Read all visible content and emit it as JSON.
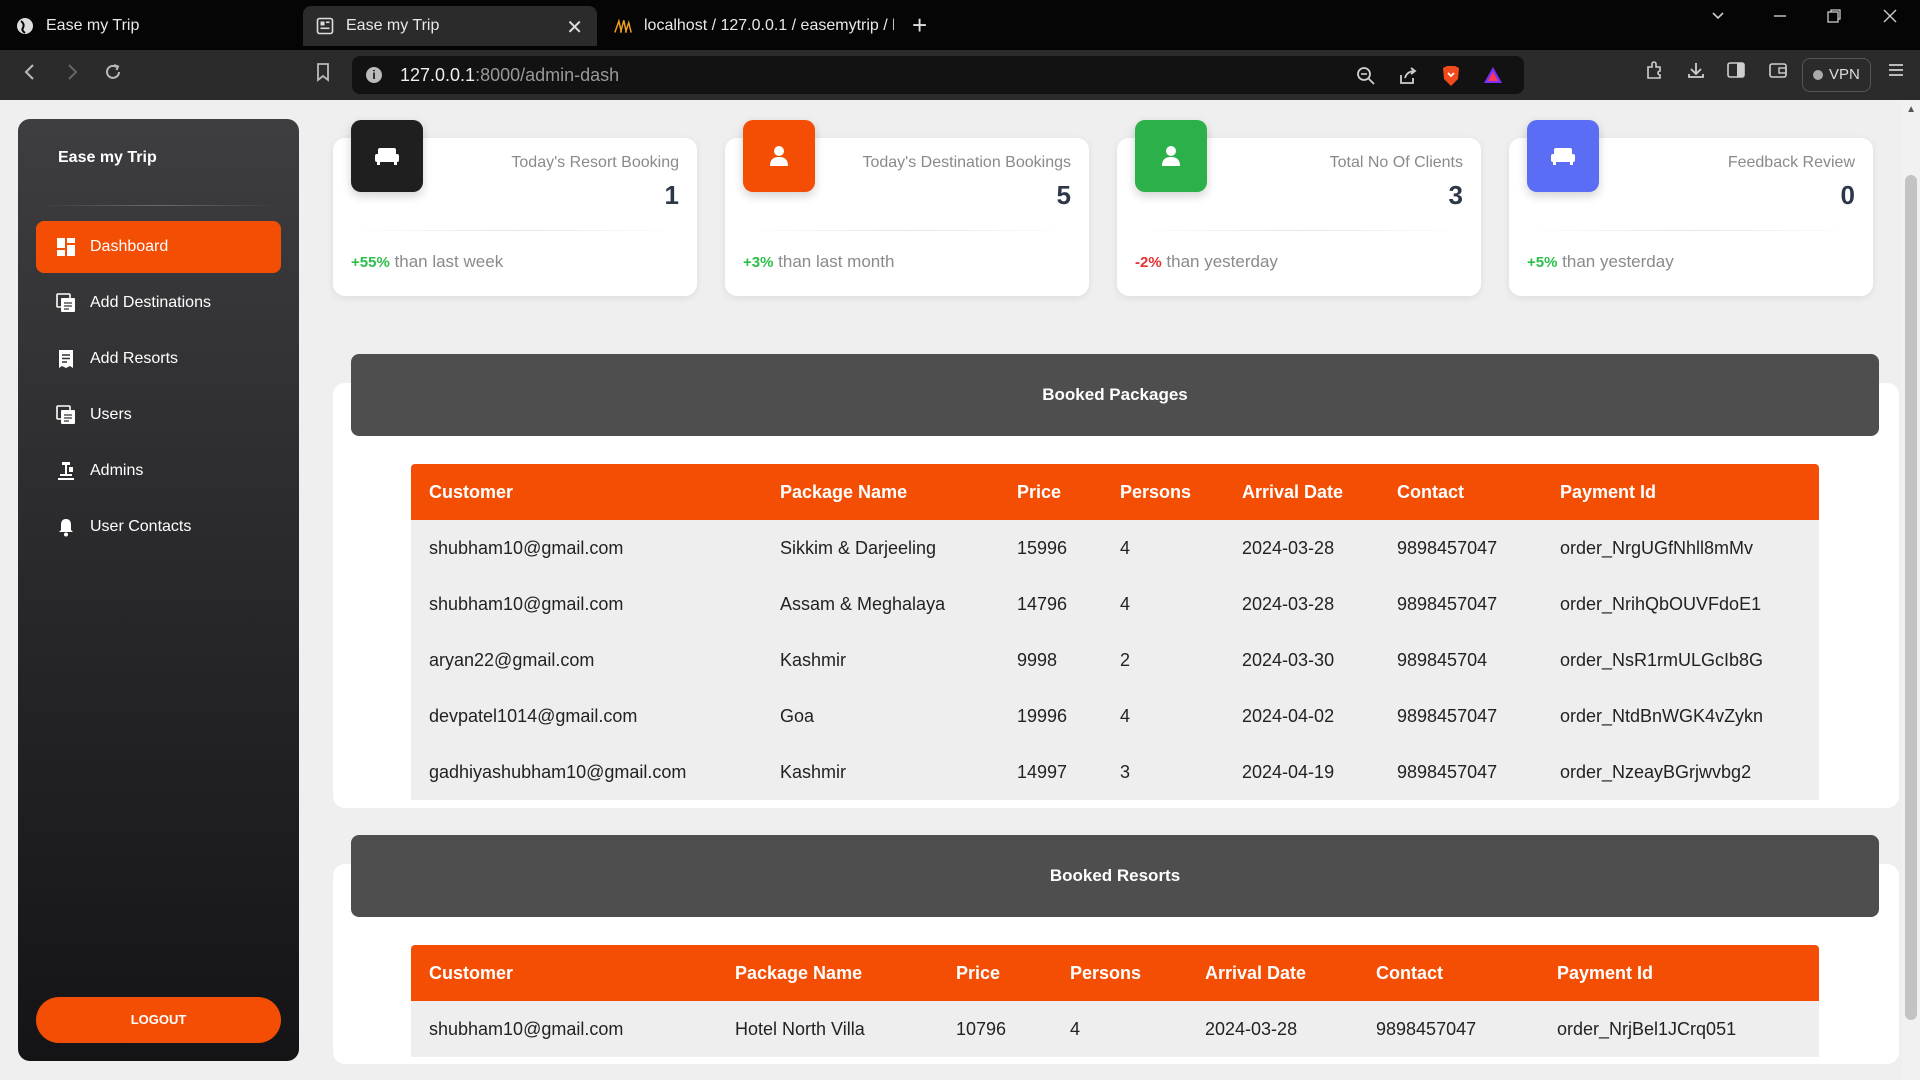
{
  "browser": {
    "tabs": [
      {
        "title": "Ease my Trip"
      },
      {
        "title": "Ease my Trip"
      },
      {
        "title": "localhost / 127.0.0.1 / easemytrip / b"
      }
    ],
    "url_host": "127.0.0.1",
    "url_path": ":8000/admin-dash",
    "vpn_label": "VPN"
  },
  "sidebar": {
    "brand": "Ease my Trip",
    "items": [
      {
        "label": "Dashboard",
        "icon": "dashboard-icon"
      },
      {
        "label": "Add Destinations",
        "icon": "copy-icon"
      },
      {
        "label": "Add Resorts",
        "icon": "receipt-icon"
      },
      {
        "label": "Users",
        "icon": "copy-icon"
      },
      {
        "label": "Admins",
        "icon": "user-tie-icon"
      },
      {
        "label": "User Contacts",
        "icon": "bell-icon"
      }
    ],
    "logout": "LOGOUT"
  },
  "cards": [
    {
      "title": "Today's Resort Booking",
      "value": "1",
      "change": "+55%",
      "change_text": " than last week",
      "color": "#1f1f1f",
      "icon": "sofa-icon"
    },
    {
      "title": "Today's Destination Bookings",
      "value": "5",
      "change": "+3%",
      "change_text": " than last month",
      "color": "#f44e04",
      "icon": "person-icon"
    },
    {
      "title": "Total No Of Clients",
      "value": "3",
      "change": "-2%",
      "change_text": " than yesterday",
      "color": "#2bb04a",
      "icon": "person-icon"
    },
    {
      "title": "Feedback Review",
      "value": "0",
      "change": "+5%",
      "change_text": " than yesterday",
      "color": "#5b6cf5",
      "icon": "sofa-icon"
    }
  ],
  "booked_packages": {
    "title": "Booked Packages",
    "columns": [
      "Customer",
      "Package Name",
      "Price",
      "Persons",
      "Arrival Date",
      "Contact",
      "Payment Id"
    ],
    "rows": [
      [
        "shubham10@gmail.com",
        "Sikkim & Darjeeling",
        "15996",
        "4",
        "2024-03-28",
        "9898457047",
        "order_NrgUGfNhll8mMv"
      ],
      [
        "shubham10@gmail.com",
        "Assam & Meghalaya",
        "14796",
        "4",
        "2024-03-28",
        "9898457047",
        "order_NrihQbOUVFdoE1"
      ],
      [
        "aryan22@gmail.com",
        "Kashmir",
        "9998",
        "2",
        "2024-03-30",
        "989845704",
        "order_NsR1rmULGcIb8G"
      ],
      [
        "devpatel1014@gmail.com",
        "Goa",
        "19996",
        "4",
        "2024-04-02",
        "9898457047",
        "order_NtdBnWGK4vZykn"
      ],
      [
        "gadhiyashubham10@gmail.com",
        "Kashmir",
        "14997",
        "3",
        "2024-04-19",
        "9898457047",
        "order_NzeayBGrjwvbg2"
      ]
    ]
  },
  "booked_resorts": {
    "title": "Booked Resorts",
    "columns": [
      "Customer",
      "Package Name",
      "Price",
      "Persons",
      "Arrival Date",
      "Contact",
      "Payment Id"
    ],
    "rows": [
      [
        "shubham10@gmail.com",
        "Hotel North Villa",
        "10796",
        "4",
        "2024-03-28",
        "9898457047",
        "order_NrjBel1JCrq051"
      ]
    ]
  }
}
